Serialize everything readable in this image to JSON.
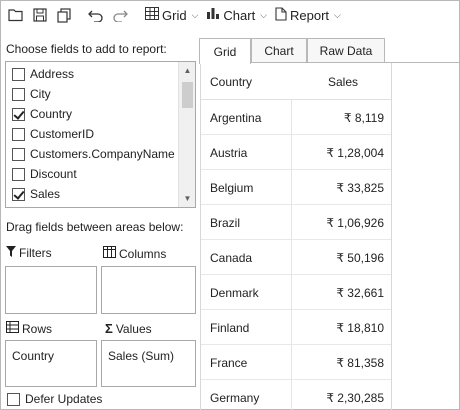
{
  "toolbar": {
    "grid_label": "Grid",
    "chart_label": "Chart",
    "report_label": "Report"
  },
  "fields_panel": {
    "title": "Choose fields to add to report:",
    "fields": [
      {
        "label": "Address",
        "checked": false
      },
      {
        "label": "City",
        "checked": false
      },
      {
        "label": "Country",
        "checked": true
      },
      {
        "label": "CustomerID",
        "checked": false
      },
      {
        "label": "Customers.CompanyName",
        "checked": false
      },
      {
        "label": "Discount",
        "checked": false
      },
      {
        "label": "Sales",
        "checked": true
      }
    ]
  },
  "areas": {
    "instruction": "Drag fields between areas below:",
    "filters_label": "Filters",
    "columns_label": "Columns",
    "rows_label": "Rows",
    "values_label": "Values",
    "rows_items": [
      "Country"
    ],
    "values_items": [
      "Sales (Sum)"
    ]
  },
  "defer_updates": {
    "label": "Defer Updates",
    "checked": false
  },
  "tabs": [
    {
      "label": "Grid",
      "active": true
    },
    {
      "label": "Chart",
      "active": false
    },
    {
      "label": "Raw Data",
      "active": false
    }
  ],
  "grid": {
    "columns": [
      "Country",
      "Sales"
    ],
    "rows": [
      {
        "country": "Argentina",
        "sales": "₹ 8,119"
      },
      {
        "country": "Austria",
        "sales": "₹ 1,28,004"
      },
      {
        "country": "Belgium",
        "sales": "₹ 33,825"
      },
      {
        "country": "Brazil",
        "sales": "₹ 1,06,926"
      },
      {
        "country": "Canada",
        "sales": "₹ 50,196"
      },
      {
        "country": "Denmark",
        "sales": "₹ 32,661"
      },
      {
        "country": "Finland",
        "sales": "₹ 18,810"
      },
      {
        "country": "France",
        "sales": "₹ 81,358"
      },
      {
        "country": "Germany",
        "sales": "₹ 2,30,285"
      }
    ]
  },
  "icons": {
    "open": "folder-open-icon",
    "save": "save-icon",
    "copy": "copy-icon",
    "undo": "undo-icon",
    "redo": "redo-icon",
    "grid": "grid-icon",
    "chart": "bar-chart-icon",
    "report": "document-icon",
    "filter": "filter-icon",
    "columns": "columns-icon",
    "rows": "rows-icon",
    "values": "sigma-icon"
  }
}
